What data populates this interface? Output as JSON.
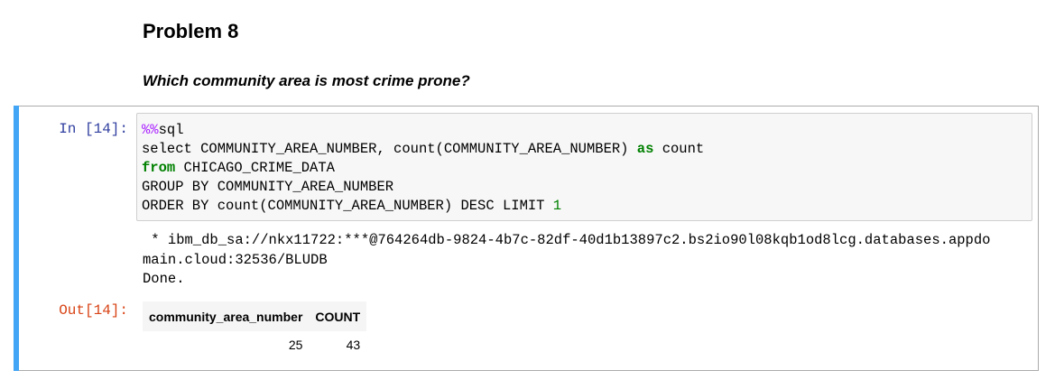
{
  "markdown": {
    "heading": "Problem 8",
    "question": "Which community area is most crime prone?"
  },
  "cell": {
    "in_prompt": "In [14]:",
    "out_prompt": "Out[14]:",
    "code": {
      "l1_magic": "%%",
      "l1_rest": "sql",
      "l2_a": "select COMMUNITY_AREA_NUMBER, count(COMMUNITY_AREA_NUMBER) ",
      "l2_kw": "as",
      "l2_b": " count",
      "l3_kw": "from",
      "l3_rest": " CHICAGO_CRIME_DATA",
      "l4": "GROUP BY COMMUNITY_AREA_NUMBER",
      "l5_a": "ORDER BY count(COMMUNITY_AREA_NUMBER) DESC LIMIT ",
      "l5_num": "1"
    },
    "stream": {
      "line1": " * ibm_db_sa://nkx11722:***@764264db-9824-4b7c-82df-40d1b13897c2.bs2io90l08kqb1od8lcg.databases.appdo",
      "line2": "main.cloud:32536/BLUDB",
      "line3": "Done."
    },
    "result_table": {
      "columns": [
        "community_area_number",
        "COUNT"
      ],
      "rows": [
        [
          "25",
          "43"
        ]
      ]
    }
  },
  "colors": {
    "cell_bar": "#42a5f5",
    "in_prompt": "#303f9f",
    "out_prompt": "#d84315",
    "keyword": "#008000",
    "magic": "#aa22ff"
  }
}
